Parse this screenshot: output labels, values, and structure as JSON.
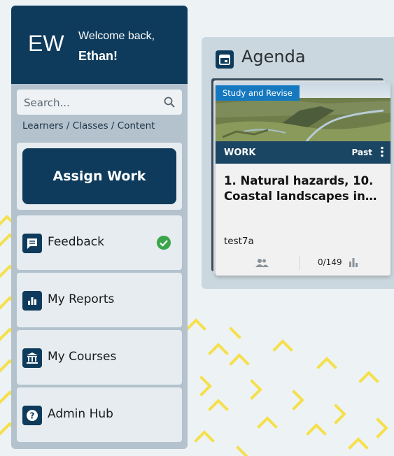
{
  "user": {
    "initials": "EW",
    "welcome": "Welcome back,",
    "name": "Ethan!"
  },
  "search": {
    "placeholder": "Search..."
  },
  "breadcrumb": [
    "Learners",
    "Classes",
    "Content"
  ],
  "breadcrumb_separator": " / ",
  "assign_button": "Assign Work",
  "nav": [
    {
      "label": "Feedback",
      "icon": "feedback-icon",
      "status": "check-icon"
    },
    {
      "label": "My Reports",
      "icon": "reports-icon"
    },
    {
      "label": "My Courses",
      "icon": "courses-icon"
    },
    {
      "label": "Admin Hub",
      "icon": "help-icon"
    }
  ],
  "agenda": {
    "title": "Agenda",
    "icon": "calendar-icon",
    "card": {
      "tag": "Study and Revise",
      "type": "WORK",
      "status": "Past",
      "title": "1. Natural hazards, 10. Coastal landscapes in ...",
      "class_name": "test7a",
      "progress": "0/149"
    }
  },
  "colors": {
    "navy": "#0e3b5c",
    "sidebar_bg": "#b3c2cd",
    "tag_blue": "#1679c0",
    "check_green": "#3aa54a",
    "pattern_yellow": "#f5e04a"
  }
}
